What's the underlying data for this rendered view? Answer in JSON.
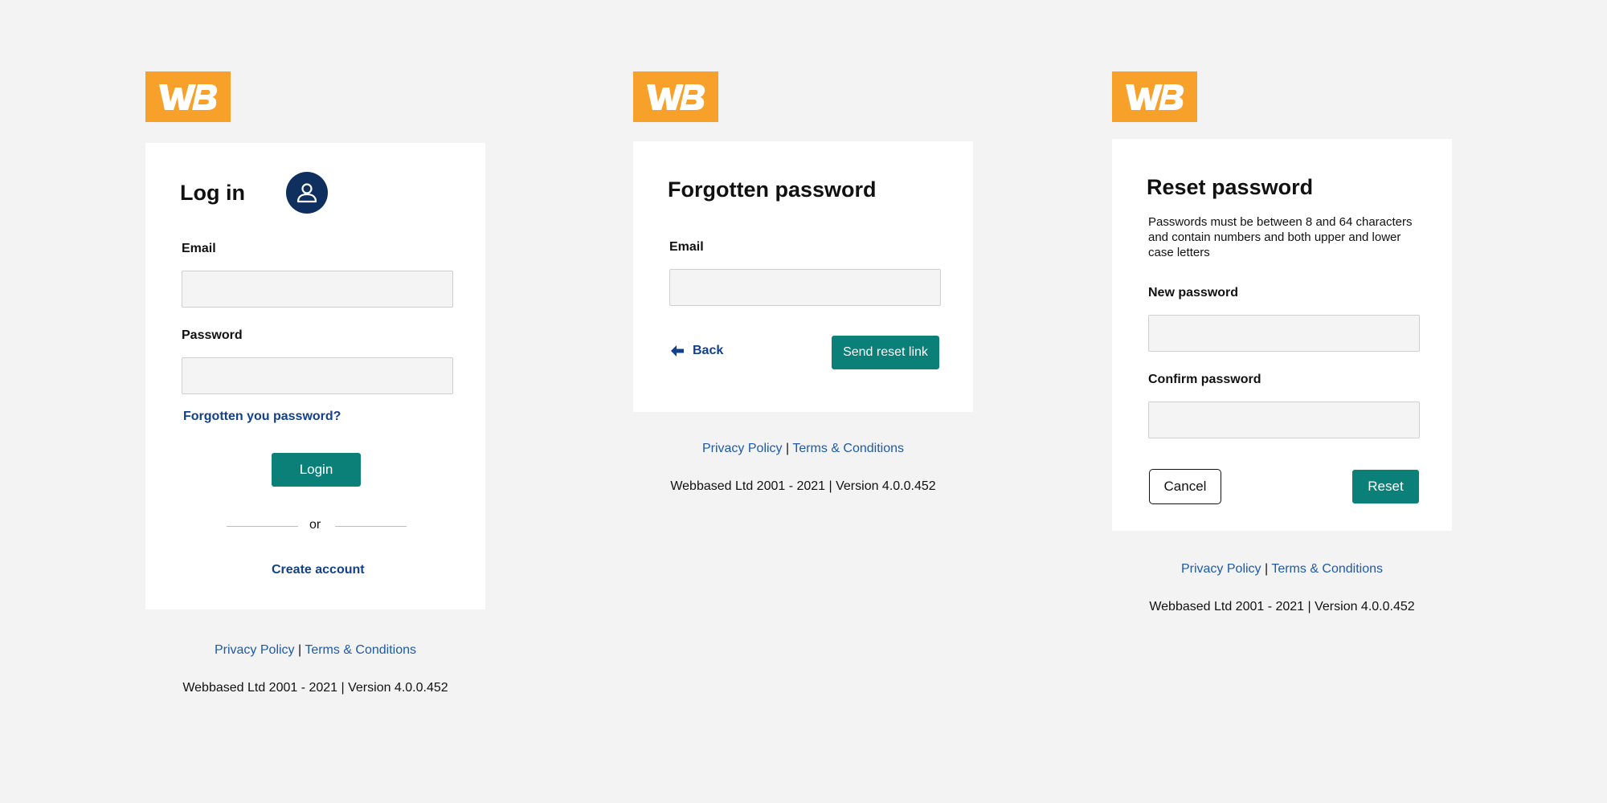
{
  "brand": {
    "logo_text": "WB",
    "logo_color": "#f7a12b",
    "accent_teal": "#0b8079",
    "link_blue": "#12408a"
  },
  "login": {
    "title": "Log in",
    "avatar_icon": "user-icon",
    "email_label": "Email",
    "email_value": "",
    "password_label": "Password",
    "password_value": "",
    "forgot_link": "Forgotten you password?",
    "login_button": "Login",
    "divider_text": "or",
    "create_account_link": "Create account"
  },
  "forgot": {
    "title": "Forgotten password",
    "email_label": "Email",
    "email_value": "",
    "back_link": "Back",
    "back_icon": "arrow-left-icon",
    "send_button": "Send reset link"
  },
  "reset": {
    "title": "Reset password",
    "help_text": "Passwords must be between 8 and 64 characters and contain numbers and both upper and lower case letters",
    "new_password_label": "New password",
    "new_password_value": "",
    "confirm_password_label": "Confirm password",
    "confirm_password_value": "",
    "cancel_button": "Cancel",
    "reset_button": "Reset"
  },
  "footer": {
    "privacy": "Privacy Policy",
    "separator": "|",
    "terms": "Terms & Conditions",
    "copyright": "Webbased Ltd 2001 - 2021 | Version 4.0.0.452"
  }
}
